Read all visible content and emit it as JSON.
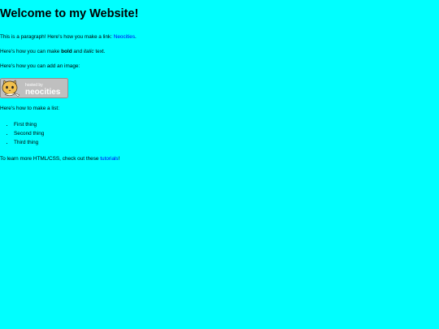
{
  "page": {
    "title": "Welcome to my Website!",
    "background": "#00ffff",
    "link_color": "#0000ee"
  },
  "intro": {
    "text": "This is a paragraph! Here's how you make a link: ",
    "link_label": "Neocities",
    "suffix": "."
  },
  "formatting": {
    "prefix": "Here's how you can make ",
    "bold": "bold",
    "middle": " and ",
    "italic": "italic",
    "suffix": " text."
  },
  "image_section": {
    "text": "Here's how you can add an image:",
    "badge": {
      "small_text": "hosted by",
      "brand": "neocities",
      "icon": "cat-icon"
    }
  },
  "list_section": {
    "text": "Here's how to make a list:",
    "items": [
      "First thing",
      "Second thing",
      "Third thing"
    ]
  },
  "footer_text": {
    "prefix": "To learn more HTML/CSS, check out these ",
    "link_label": "tutorials",
    "suffix": "!"
  }
}
